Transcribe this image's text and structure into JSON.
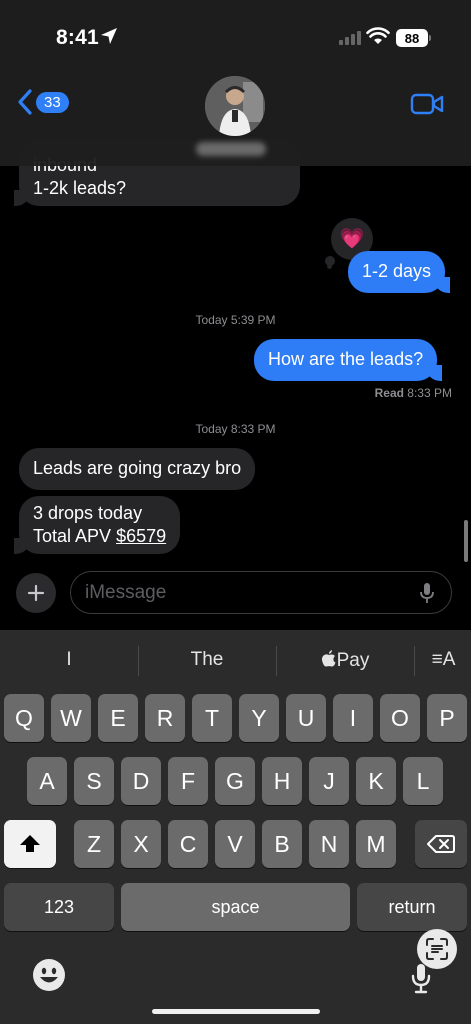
{
  "status_bar": {
    "time": "8:41",
    "battery": "88"
  },
  "header": {
    "back_badge": "33"
  },
  "messages": {
    "m1_line1": "inbound",
    "m1_line2": "1-2k leads?",
    "tapback_emoji": "💗",
    "m2": "1-2 days",
    "ts1": "Today 5:39 PM",
    "m3": "How are the leads?",
    "read_label": "Read",
    "read_time": "8:33 PM",
    "ts2": "Today 8:33 PM",
    "m4": "Leads are going crazy bro",
    "m5_line1": "3 drops today",
    "m5_line2_prefix": "Total APV ",
    "m5_line2_link": "$6579"
  },
  "composer": {
    "placeholder": "iMessage"
  },
  "keyboard": {
    "predictions": [
      "I",
      "The",
      "Pay",
      "≡A"
    ],
    "row1": [
      "Q",
      "W",
      "E",
      "R",
      "T",
      "Y",
      "U",
      "I",
      "O",
      "P"
    ],
    "row2": [
      "A",
      "S",
      "D",
      "F",
      "G",
      "H",
      "J",
      "K",
      "L"
    ],
    "row3": [
      "Z",
      "X",
      "C",
      "V",
      "B",
      "N",
      "M"
    ],
    "numbers_key": "123",
    "space_key": "space",
    "return_key": "return"
  },
  "colors": {
    "sent_bubble": "#2e7cf6",
    "received_bubble": "#262629",
    "accent": "#2f7ff7"
  }
}
